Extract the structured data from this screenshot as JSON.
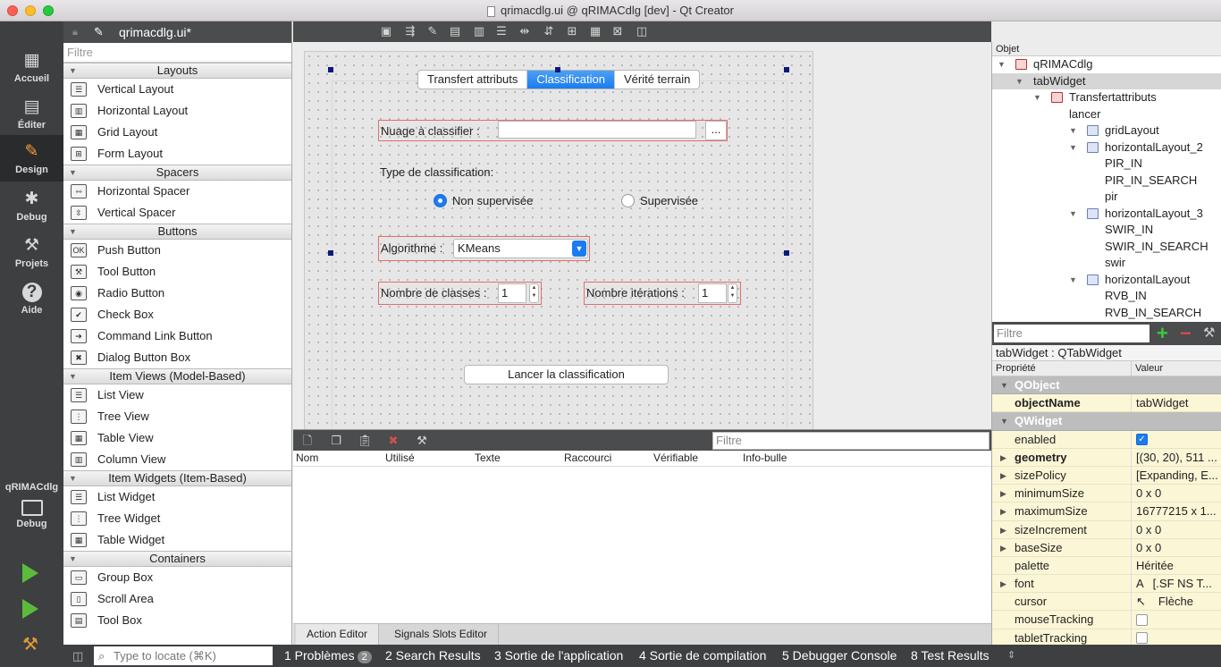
{
  "window": {
    "title": "qrimacdlg.ui @ qRIMACdlg [dev] - Qt Creator"
  },
  "modes": [
    {
      "label": "Accueil",
      "icon": "grid-icon"
    },
    {
      "label": "Éditer",
      "icon": "document-icon"
    },
    {
      "label": "Design",
      "icon": "pencil-icon"
    },
    {
      "label": "Debug",
      "icon": "bug-icon"
    },
    {
      "label": "Projets",
      "icon": "wrench-icon"
    },
    {
      "label": "Aide",
      "icon": "help-icon"
    }
  ],
  "target": {
    "project": "qRIMACdlg",
    "mode": "Debug"
  },
  "widgetbox": {
    "file": "qrimacdlg.ui*",
    "filter_placeholder": "Filtre",
    "categories": [
      {
        "name": "Layouts",
        "items": [
          "Vertical Layout",
          "Horizontal Layout",
          "Grid Layout",
          "Form Layout"
        ]
      },
      {
        "name": "Spacers",
        "items": [
          "Horizontal Spacer",
          "Vertical Spacer"
        ]
      },
      {
        "name": "Buttons",
        "items": [
          "Push Button",
          "Tool Button",
          "Radio Button",
          "Check Box",
          "Command Link Button",
          "Dialog Button Box"
        ]
      },
      {
        "name": "Item Views (Model-Based)",
        "items": [
          "List View",
          "Tree View",
          "Table View",
          "Column View"
        ]
      },
      {
        "name": "Item Widgets (Item-Based)",
        "items": [
          "List Widget",
          "Tree Widget",
          "Table Widget"
        ]
      },
      {
        "name": "Containers",
        "items": [
          "Group Box",
          "Scroll Area",
          "Tool Box"
        ]
      }
    ]
  },
  "form": {
    "tabs": [
      "Transfert attributs",
      "Classification",
      "Vérité terrain"
    ],
    "nuage_label": "Nuage à classifier :",
    "nuage_value": "",
    "browse_label": "...",
    "type_label": "Type de classification:",
    "radio_unsup": "Non supervisée",
    "radio_sup": "Supervisée",
    "algo_label": "Algorithme :",
    "algo_value": "KMeans",
    "classes_label": "Nombre de classes :",
    "classes_value": "1",
    "iter_label": "Nombre itérations :",
    "iter_value": "1",
    "run_button": "Lancer la classification"
  },
  "action_editor": {
    "filter_placeholder": "Filtre",
    "columns": [
      "Nom",
      "Utilisé",
      "Texte",
      "Raccourci",
      "Vérifiable",
      "Info-bulle"
    ],
    "tabs": [
      "Action Editor",
      "Signals  Slots Editor"
    ]
  },
  "object_inspector": {
    "header": "Objet",
    "rows": [
      "qRIMACdlg",
      "tabWidget",
      "Transfertattributs",
      "lancer",
      "gridLayout",
      "horizontalLayout_2",
      "PIR_IN",
      "PIR_IN_SEARCH",
      "pir",
      "horizontalLayout_3",
      "SWIR_IN",
      "SWIR_IN_SEARCH",
      "swir",
      "horizontalLayout",
      "RVB_IN",
      "RVB_IN_SEARCH"
    ]
  },
  "property_editor": {
    "filter_placeholder": "Filtre",
    "class_label": "tabWidget : QTabWidget",
    "col_property": "Propriété",
    "col_value": "Valeur",
    "rows": [
      {
        "name": "QObject",
        "value": ""
      },
      {
        "name": "objectName",
        "value": "tabWidget"
      },
      {
        "name": "QWidget",
        "value": ""
      },
      {
        "name": "enabled",
        "value": ""
      },
      {
        "name": "geometry",
        "value": "[(30, 20), 511 ..."
      },
      {
        "name": "sizePolicy",
        "value": "[Expanding, E..."
      },
      {
        "name": "minimumSize",
        "value": "0 x 0"
      },
      {
        "name": "maximumSize",
        "value": "16777215 x 1..."
      },
      {
        "name": "sizeIncrement",
        "value": "0 x 0"
      },
      {
        "name": "baseSize",
        "value": "0 x 0"
      },
      {
        "name": "palette",
        "value": "Héritée"
      },
      {
        "name": "font",
        "value": "[.SF NS T..."
      },
      {
        "name": "cursor",
        "value": "Flèche"
      },
      {
        "name": "mouseTracking",
        "value": ""
      },
      {
        "name": "tabletTracking",
        "value": ""
      }
    ],
    "font_glyph": "A"
  },
  "statusbar": {
    "locate_placeholder": "Type to locate (⌘K)",
    "items": [
      "1  Problèmes",
      "2  Search Results",
      "3  Sortie de l'application",
      "4  Sortie de compilation",
      "5  Debugger Console",
      "8  Test Results"
    ],
    "problems_count": "2"
  }
}
